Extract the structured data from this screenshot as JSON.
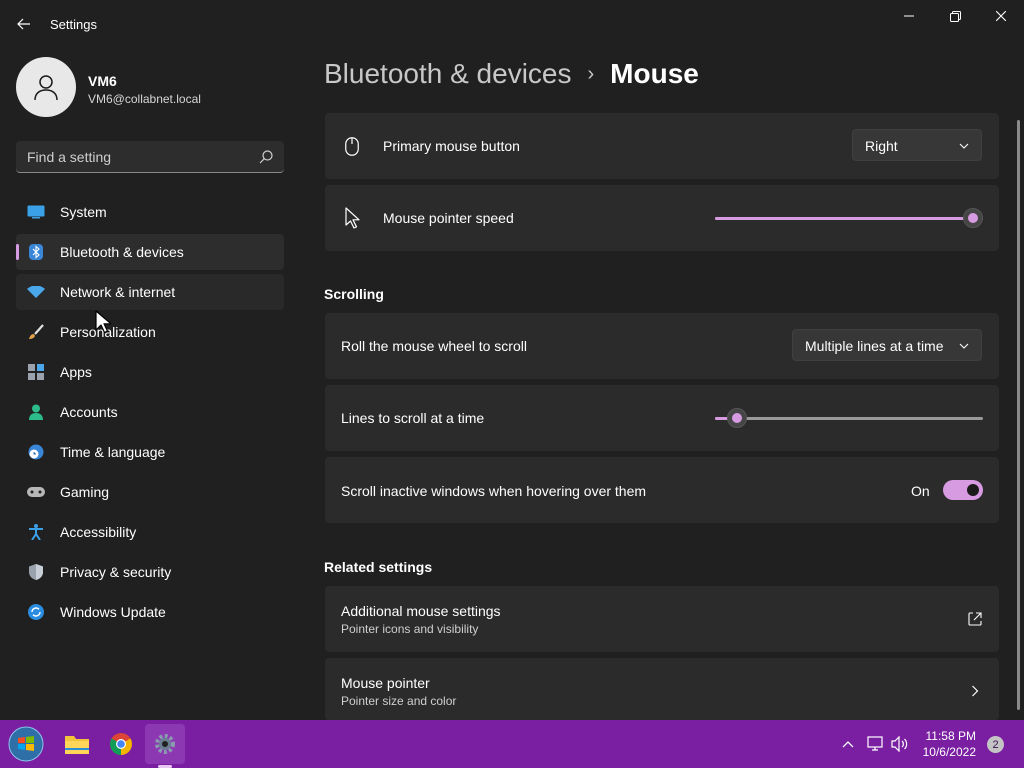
{
  "window": {
    "title": "Settings",
    "controls": {
      "minimize": "minimize-icon",
      "maximize": "restore-icon",
      "close": "close-icon"
    }
  },
  "profile": {
    "name": "VM6",
    "email": "VM6@collabnet.local"
  },
  "search": {
    "placeholder": "Find a setting"
  },
  "sidebar": {
    "items": [
      {
        "label": "System",
        "icon": "system-icon"
      },
      {
        "label": "Bluetooth & devices",
        "icon": "bluetooth-icon",
        "selected": true
      },
      {
        "label": "Network & internet",
        "icon": "wifi-icon",
        "hovered": true
      },
      {
        "label": "Personalization",
        "icon": "brush-icon"
      },
      {
        "label": "Apps",
        "icon": "apps-icon"
      },
      {
        "label": "Accounts",
        "icon": "person-icon"
      },
      {
        "label": "Time & language",
        "icon": "clock-globe-icon"
      },
      {
        "label": "Gaming",
        "icon": "gamepad-icon"
      },
      {
        "label": "Accessibility",
        "icon": "accessibility-icon"
      },
      {
        "label": "Privacy & security",
        "icon": "shield-icon"
      },
      {
        "label": "Windows Update",
        "icon": "update-icon"
      }
    ]
  },
  "header": {
    "parent": "Bluetooth & devices",
    "separator": "›",
    "current": "Mouse"
  },
  "settings": {
    "primary_button": {
      "label": "Primary mouse button",
      "value": "Right",
      "icon": "mouse-icon"
    },
    "pointer_speed": {
      "label": "Mouse pointer speed",
      "value_fraction": 1.0,
      "icon": "pointer-icon"
    },
    "scrolling_title": "Scrolling",
    "roll_wheel": {
      "label": "Roll the mouse wheel to scroll",
      "value": "Multiple lines at a time"
    },
    "lines_to_scroll": {
      "label": "Lines to scroll at a time",
      "value_fraction": 0.05
    },
    "scroll_inactive": {
      "label": "Scroll inactive windows when hovering over them",
      "state_label": "On",
      "on": true
    },
    "related_title": "Related settings",
    "additional": {
      "label": "Additional mouse settings",
      "sublabel": "Pointer icons and visibility",
      "icon": "open-external-icon"
    },
    "mouse_pointer": {
      "label": "Mouse pointer",
      "sublabel": "Pointer size and color",
      "icon": "chevron-right-icon"
    }
  },
  "taskbar": {
    "apps": [
      "start-orb-icon",
      "file-explorer-icon",
      "chrome-icon",
      "settings-gear-icon"
    ],
    "tray": [
      "chevron-up-icon",
      "network-icon",
      "volume-icon"
    ],
    "time": "11:58 PM",
    "date": "10/6/2022",
    "notifications": "2"
  },
  "colors": {
    "accent": "#d69be0",
    "taskbar": "#7a1fa2",
    "background": "#202020",
    "card": "#2b2b2b"
  }
}
